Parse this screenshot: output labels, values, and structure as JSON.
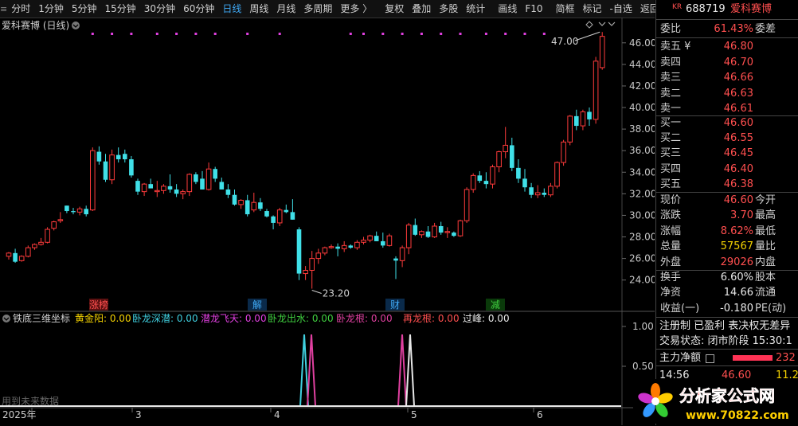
{
  "toolbar": {
    "items": [
      "分时",
      "1分钟",
      "5分钟",
      "15分钟",
      "30分钟",
      "60分钟",
      "日线",
      "周线",
      "月线",
      "多周期",
      "更多 〉",
      "复权",
      "叠加",
      "多股",
      "统计",
      "画线",
      "F10",
      "简框",
      "标记",
      "-自选",
      "返回"
    ],
    "active_index": 6
  },
  "chart": {
    "title": "爱科赛博 (日线)",
    "high_label": "47.00",
    "low_label": "23.20",
    "year_label": "2025年",
    "month_labels": [
      "3",
      "4",
      "5",
      "6"
    ],
    "events": [
      {
        "label": "涨榜",
        "color": "#ff4f4f",
        "bg": "#5a1010"
      },
      {
        "label": "解",
        "color": "#3fa9f5",
        "bg": "#0a2a4a"
      },
      {
        "label": "财",
        "color": "#3fa9f5",
        "bg": "#0a2a4a"
      },
      {
        "label": "减",
        "color": "#40d040",
        "bg": "#0a3a0a"
      }
    ],
    "indicator_title": "铁底三维坐标",
    "indicator_items": [
      {
        "label": "黄金阳: 0.00",
        "color": "#f5d300"
      },
      {
        "label": "卧龙深潜: 0.00",
        "color": "#40d0e0"
      },
      {
        "label": "潜龙飞天: 0.00",
        "color": "#e040e0"
      },
      {
        "label": "卧龙出水: 0.00",
        "color": "#40d040"
      },
      {
        "label": "卧龙根: 0.00",
        "color": "#e040a0"
      },
      {
        "label": "再龙根: 0.00",
        "color": "#ff4f4f"
      },
      {
        "label": "过峰: 0.00",
        "color": "#e8e8e8"
      }
    ],
    "future_note": "用到未来数据",
    "indicator_axis": [
      "1.00",
      "0.50"
    ]
  },
  "chart_data": {
    "type": "candlestick",
    "title": "爱科赛博 (日线)",
    "ylim": [
      22.5,
      48.2
    ],
    "yticks": [
      24,
      26,
      28,
      30,
      32,
      34,
      36,
      38,
      40,
      42,
      44,
      46
    ],
    "ohlc": [
      [
        26.2,
        26.6,
        25.9,
        26.5
      ],
      [
        26.5,
        26.9,
        25.6,
        25.7
      ],
      [
        25.8,
        26.3,
        25.7,
        26.2
      ],
      [
        26.2,
        27.2,
        26.1,
        27.0
      ],
      [
        27.0,
        27.4,
        26.8,
        27.3
      ],
      [
        27.3,
        27.9,
        27.2,
        27.5
      ],
      [
        27.5,
        28.9,
        27.4,
        28.7
      ],
      [
        28.8,
        29.5,
        28.6,
        29.4
      ],
      [
        29.5,
        30.3,
        29.3,
        29.6
      ],
      [
        30.9,
        30.9,
        30.2,
        30.4
      ],
      [
        30.4,
        30.7,
        30.1,
        30.3
      ],
      [
        30.3,
        30.8,
        30.0,
        30.6
      ],
      [
        30.6,
        30.9,
        29.9,
        30.1
      ],
      [
        30.5,
        36.3,
        30.4,
        36.0
      ],
      [
        35.9,
        36.4,
        34.7,
        35.0
      ],
      [
        35.0,
        35.7,
        33.1,
        33.3
      ],
      [
        33.3,
        36.1,
        32.9,
        35.6
      ],
      [
        35.6,
        36.3,
        34.9,
        35.2
      ],
      [
        35.7,
        36.1,
        34.9,
        35.2
      ],
      [
        35.2,
        35.5,
        33.5,
        33.7
      ],
      [
        33.2,
        33.4,
        31.9,
        32.2
      ],
      [
        32.2,
        33.0,
        31.8,
        32.9
      ],
      [
        32.9,
        33.4,
        32.6,
        32.5
      ],
      [
        32.2,
        33.2,
        31.7,
        32.3
      ],
      [
        32.3,
        32.9,
        32.0,
        32.7
      ],
      [
        32.7,
        33.8,
        32.1,
        32.4
      ],
      [
        32.4,
        32.9,
        31.7,
        32.0
      ],
      [
        32.0,
        32.4,
        31.5,
        32.2
      ],
      [
        32.2,
        33.9,
        31.8,
        33.8
      ],
      [
        33.8,
        34.0,
        32.9,
        33.1
      ],
      [
        33.4,
        34.1,
        32.4,
        32.4
      ],
      [
        32.4,
        34.9,
        32.3,
        34.3
      ],
      [
        34.3,
        34.5,
        33.1,
        33.4
      ],
      [
        33.1,
        33.5,
        32.4,
        32.4
      ],
      [
        32.4,
        32.9,
        31.6,
        31.9
      ],
      [
        31.9,
        32.4,
        30.9,
        31.0
      ],
      [
        31.0,
        31.5,
        30.6,
        31.4
      ],
      [
        31.4,
        31.9,
        29.9,
        30.1
      ],
      [
        30.5,
        32.1,
        30.3,
        31.2
      ],
      [
        31.2,
        31.6,
        30.4,
        30.6
      ],
      [
        30.4,
        30.6,
        29.8,
        29.9
      ],
      [
        29.9,
        30.0,
        28.7,
        29.3
      ],
      [
        29.3,
        30.7,
        29.0,
        30.5
      ],
      [
        30.5,
        31.0,
        30.2,
        30.3
      ],
      [
        30.3,
        31.5,
        29.6,
        29.6
      ],
      [
        28.7,
        28.9,
        24.0,
        24.6
      ],
      [
        24.6,
        25.3,
        24.0,
        24.9
      ],
      [
        24.9,
        26.7,
        23.2,
        26.0
      ],
      [
        26.0,
        26.9,
        25.5,
        26.5
      ],
      [
        26.5,
        27.1,
        26.3,
        27.0
      ],
      [
        27.0,
        27.3,
        26.9,
        27.1
      ],
      [
        27.1,
        27.4,
        26.2,
        26.9
      ],
      [
        26.9,
        27.6,
        26.6,
        27.2
      ],
      [
        27.2,
        27.3,
        26.9,
        27.0
      ],
      [
        27.0,
        27.7,
        26.8,
        27.5
      ],
      [
        27.5,
        28.0,
        27.3,
        27.7
      ],
      [
        27.7,
        28.2,
        27.5,
        28.1
      ],
      [
        28.1,
        28.5,
        27.6,
        27.6
      ],
      [
        27.6,
        28.4,
        27.0,
        27.2
      ],
      [
        27.2,
        28.3,
        27.1,
        28.1
      ],
      [
        26.0,
        26.2,
        24.1,
        25.8
      ],
      [
        25.8,
        27.2,
        25.2,
        27.0
      ],
      [
        27.0,
        29.3,
        26.4,
        29.1
      ],
      [
        29.1,
        29.7,
        28.1,
        28.2
      ],
      [
        28.2,
        28.6,
        27.9,
        28.5
      ],
      [
        28.5,
        29.0,
        27.9,
        28.0
      ],
      [
        28.0,
        29.3,
        27.9,
        29.0
      ],
      [
        29.0,
        29.4,
        28.2,
        28.4
      ],
      [
        28.4,
        28.9,
        27.9,
        28.5
      ],
      [
        28.4,
        28.5,
        28.0,
        28.1
      ],
      [
        28.1,
        29.6,
        28.0,
        29.5
      ],
      [
        29.5,
        32.6,
        29.3,
        32.4
      ],
      [
        32.4,
        33.9,
        32.1,
        33.7
      ],
      [
        33.7,
        34.1,
        33.0,
        33.2
      ],
      [
        33.2,
        34.0,
        32.5,
        32.9
      ],
      [
        32.9,
        34.7,
        32.5,
        34.5
      ],
      [
        34.5,
        36.0,
        34.0,
        35.9
      ],
      [
        35.9,
        38.2,
        35.3,
        36.5
      ],
      [
        36.5,
        37.2,
        34.1,
        34.4
      ],
      [
        34.4,
        35.2,
        33.0,
        33.4
      ],
      [
        33.4,
        34.3,
        32.2,
        32.6
      ],
      [
        32.6,
        33.0,
        31.6,
        31.9
      ],
      [
        31.9,
        32.8,
        31.6,
        32.1
      ],
      [
        32.1,
        32.5,
        31.7,
        31.9
      ],
      [
        31.9,
        33.0,
        31.7,
        32.7
      ],
      [
        32.7,
        35.0,
        32.5,
        34.9
      ],
      [
        34.9,
        37.0,
        34.6,
        36.8
      ],
      [
        36.8,
        39.3,
        36.5,
        39.2
      ],
      [
        39.2,
        39.8,
        37.9,
        38.3
      ],
      [
        38.3,
        39.8,
        37.9,
        39.6
      ],
      [
        39.6,
        40.0,
        38.3,
        38.9
      ],
      [
        38.9,
        44.7,
        38.5,
        44.3
      ],
      [
        43.7,
        47.0,
        43.5,
        46.6
      ]
    ],
    "volume_max": 1,
    "event_markers": [
      "涨榜",
      "解",
      "财",
      "减"
    ],
    "x_labels": [
      "2025年",
      "3",
      "4",
      "5",
      "6"
    ]
  },
  "panel": {
    "header_code": "688719",
    "header_name": "爱科赛博",
    "header_prefix": "KR",
    "ratio_label": "委比",
    "ratio_val": "61.43%",
    "ratio_extra": "委差",
    "sells": [
      {
        "label": "卖五 ¥",
        "val": "46.80"
      },
      {
        "label": "卖四",
        "val": "46.70"
      },
      {
        "label": "卖三",
        "val": "46.66"
      },
      {
        "label": "卖二",
        "val": "46.63"
      },
      {
        "label": "卖一",
        "val": "46.61"
      }
    ],
    "buys": [
      {
        "label": "买一",
        "val": "46.60"
      },
      {
        "label": "买二",
        "val": "46.55"
      },
      {
        "label": "买三",
        "val": "46.45"
      },
      {
        "label": "买四",
        "val": "46.40"
      },
      {
        "label": "买五",
        "val": "46.38"
      }
    ],
    "stats": [
      {
        "label": "现价",
        "val": "46.60",
        "cls": "red",
        "extra": "今开"
      },
      {
        "label": "涨跌",
        "val": "3.70",
        "cls": "red",
        "extra": "最高"
      },
      {
        "label": "涨幅",
        "val": "8.62%",
        "cls": "red",
        "extra": "最低"
      },
      {
        "label": "总量",
        "val": "57567",
        "cls": "yellow",
        "extra": "量比"
      },
      {
        "label": "外盘",
        "val": "29026",
        "cls": "red",
        "extra": "内盘"
      }
    ],
    "stats2": [
      {
        "label": "换手",
        "val": "6.60%",
        "cls": "white",
        "extra": "股本"
      },
      {
        "label": "净资",
        "val": "14.66",
        "cls": "white",
        "extra": "流通"
      },
      {
        "label": "收益(一)",
        "val": "-0.180",
        "cls": "white",
        "extra": "PE(动)"
      }
    ],
    "tags": "注册制 已盈利 表决权无差异",
    "trade_status": "交易状态: 闭市阶段 15:30:1",
    "main_flow": "主力净额",
    "main_flow_val": "232",
    "tick_time": "14:56",
    "tick_price": "46.60",
    "tick_extra": "11.2"
  },
  "watermark": {
    "brand": "分析家公式网",
    "site": "www.70822.com"
  }
}
